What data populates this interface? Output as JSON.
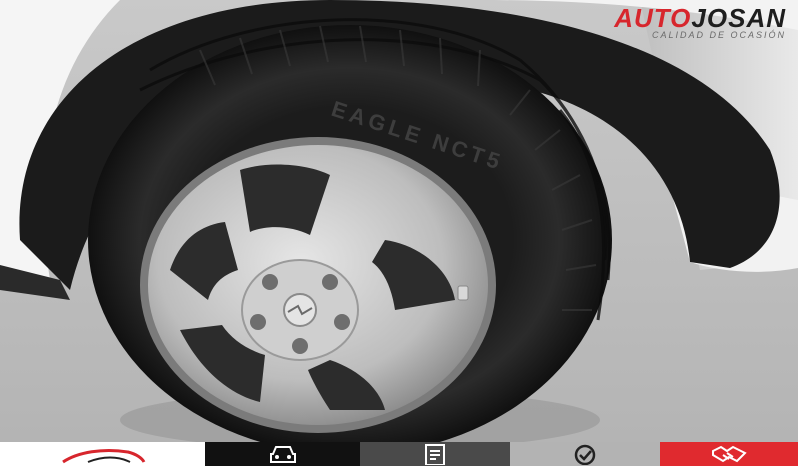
{
  "brand": {
    "name_prefix": "AUTO",
    "name_suffix": "JOSAN",
    "tagline": "CALIDAD DE OCASIÓN",
    "accent_color": "#d7262d"
  },
  "photo": {
    "subject": "car-wheel",
    "tire_sidewall_text": "EAGLE NCT5"
  },
  "bottom_bar": {
    "items": [
      {
        "icon": "car-silhouette-icon",
        "color": "#ffffff"
      },
      {
        "icon": "car-front-icon",
        "color": "#111111"
      },
      {
        "icon": "document-icon",
        "color": "#4a4a4a"
      },
      {
        "icon": "checkmark-icon",
        "color": "#b3b3b3"
      },
      {
        "icon": "handshake-icon",
        "color": "#e02a2f"
      }
    ]
  }
}
